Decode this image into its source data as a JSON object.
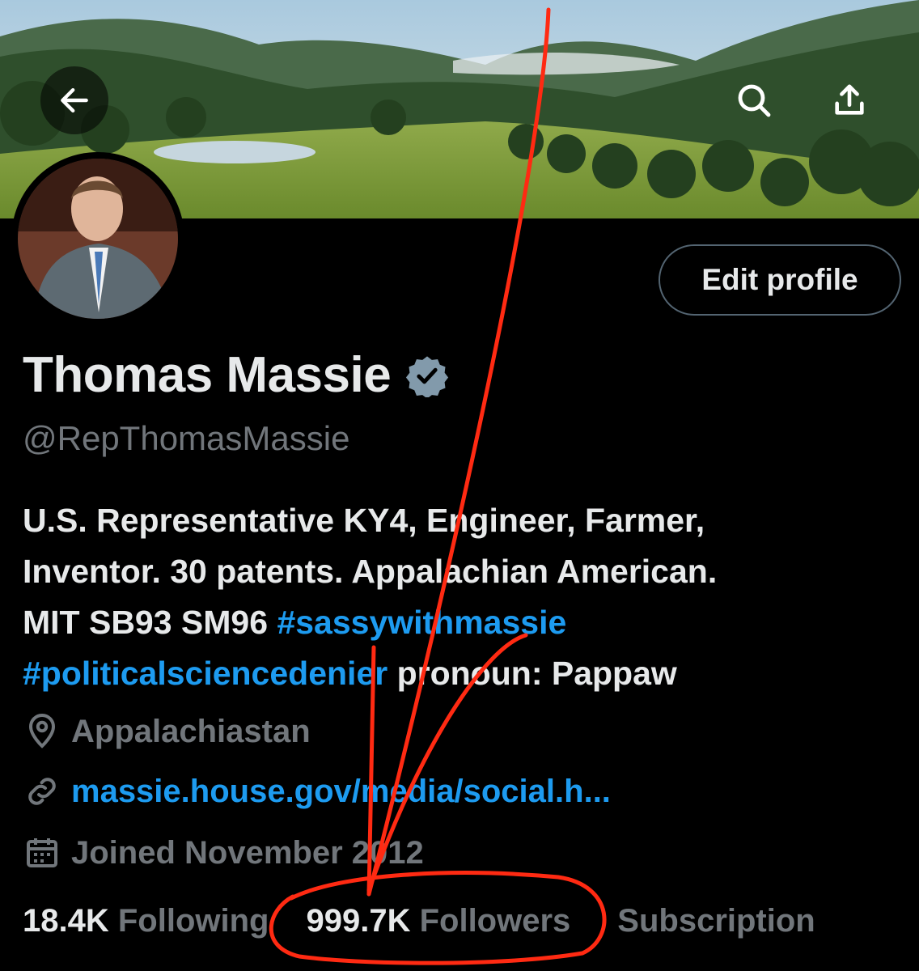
{
  "header": {
    "back_icon": "arrow-left-icon",
    "search_icon": "search-icon",
    "share_icon": "share-icon"
  },
  "profile": {
    "name": "Thomas Massie",
    "handle": "@RepThomasMassie",
    "edit_label": "Edit profile",
    "verified_color": "#829aab",
    "bio": {
      "line1": "U.S. Representative KY4, Engineer, Farmer,",
      "line2": "Inventor. 30 patents. Appalachian American.",
      "line3_text": "MIT SB93 SM96 ",
      "line3_tag": "#sassywithmassie",
      "line4_tag": "#politicalsciencedenier",
      "line4_text": " pronoun: Pappaw"
    },
    "location": "Appalachiastan",
    "link": "massie.house.gov/media/social.h...",
    "joined": "Joined November 2012"
  },
  "stats": {
    "following_count": "18.4K",
    "following_label": " Following",
    "followers_count": "999.7K",
    "followers_label": " Followers",
    "subscription_label": "Subscription"
  },
  "colors": {
    "background": "#000000",
    "accent": "#1d9bf0",
    "muted": "#71767b",
    "annotation": "#ff2a12"
  }
}
